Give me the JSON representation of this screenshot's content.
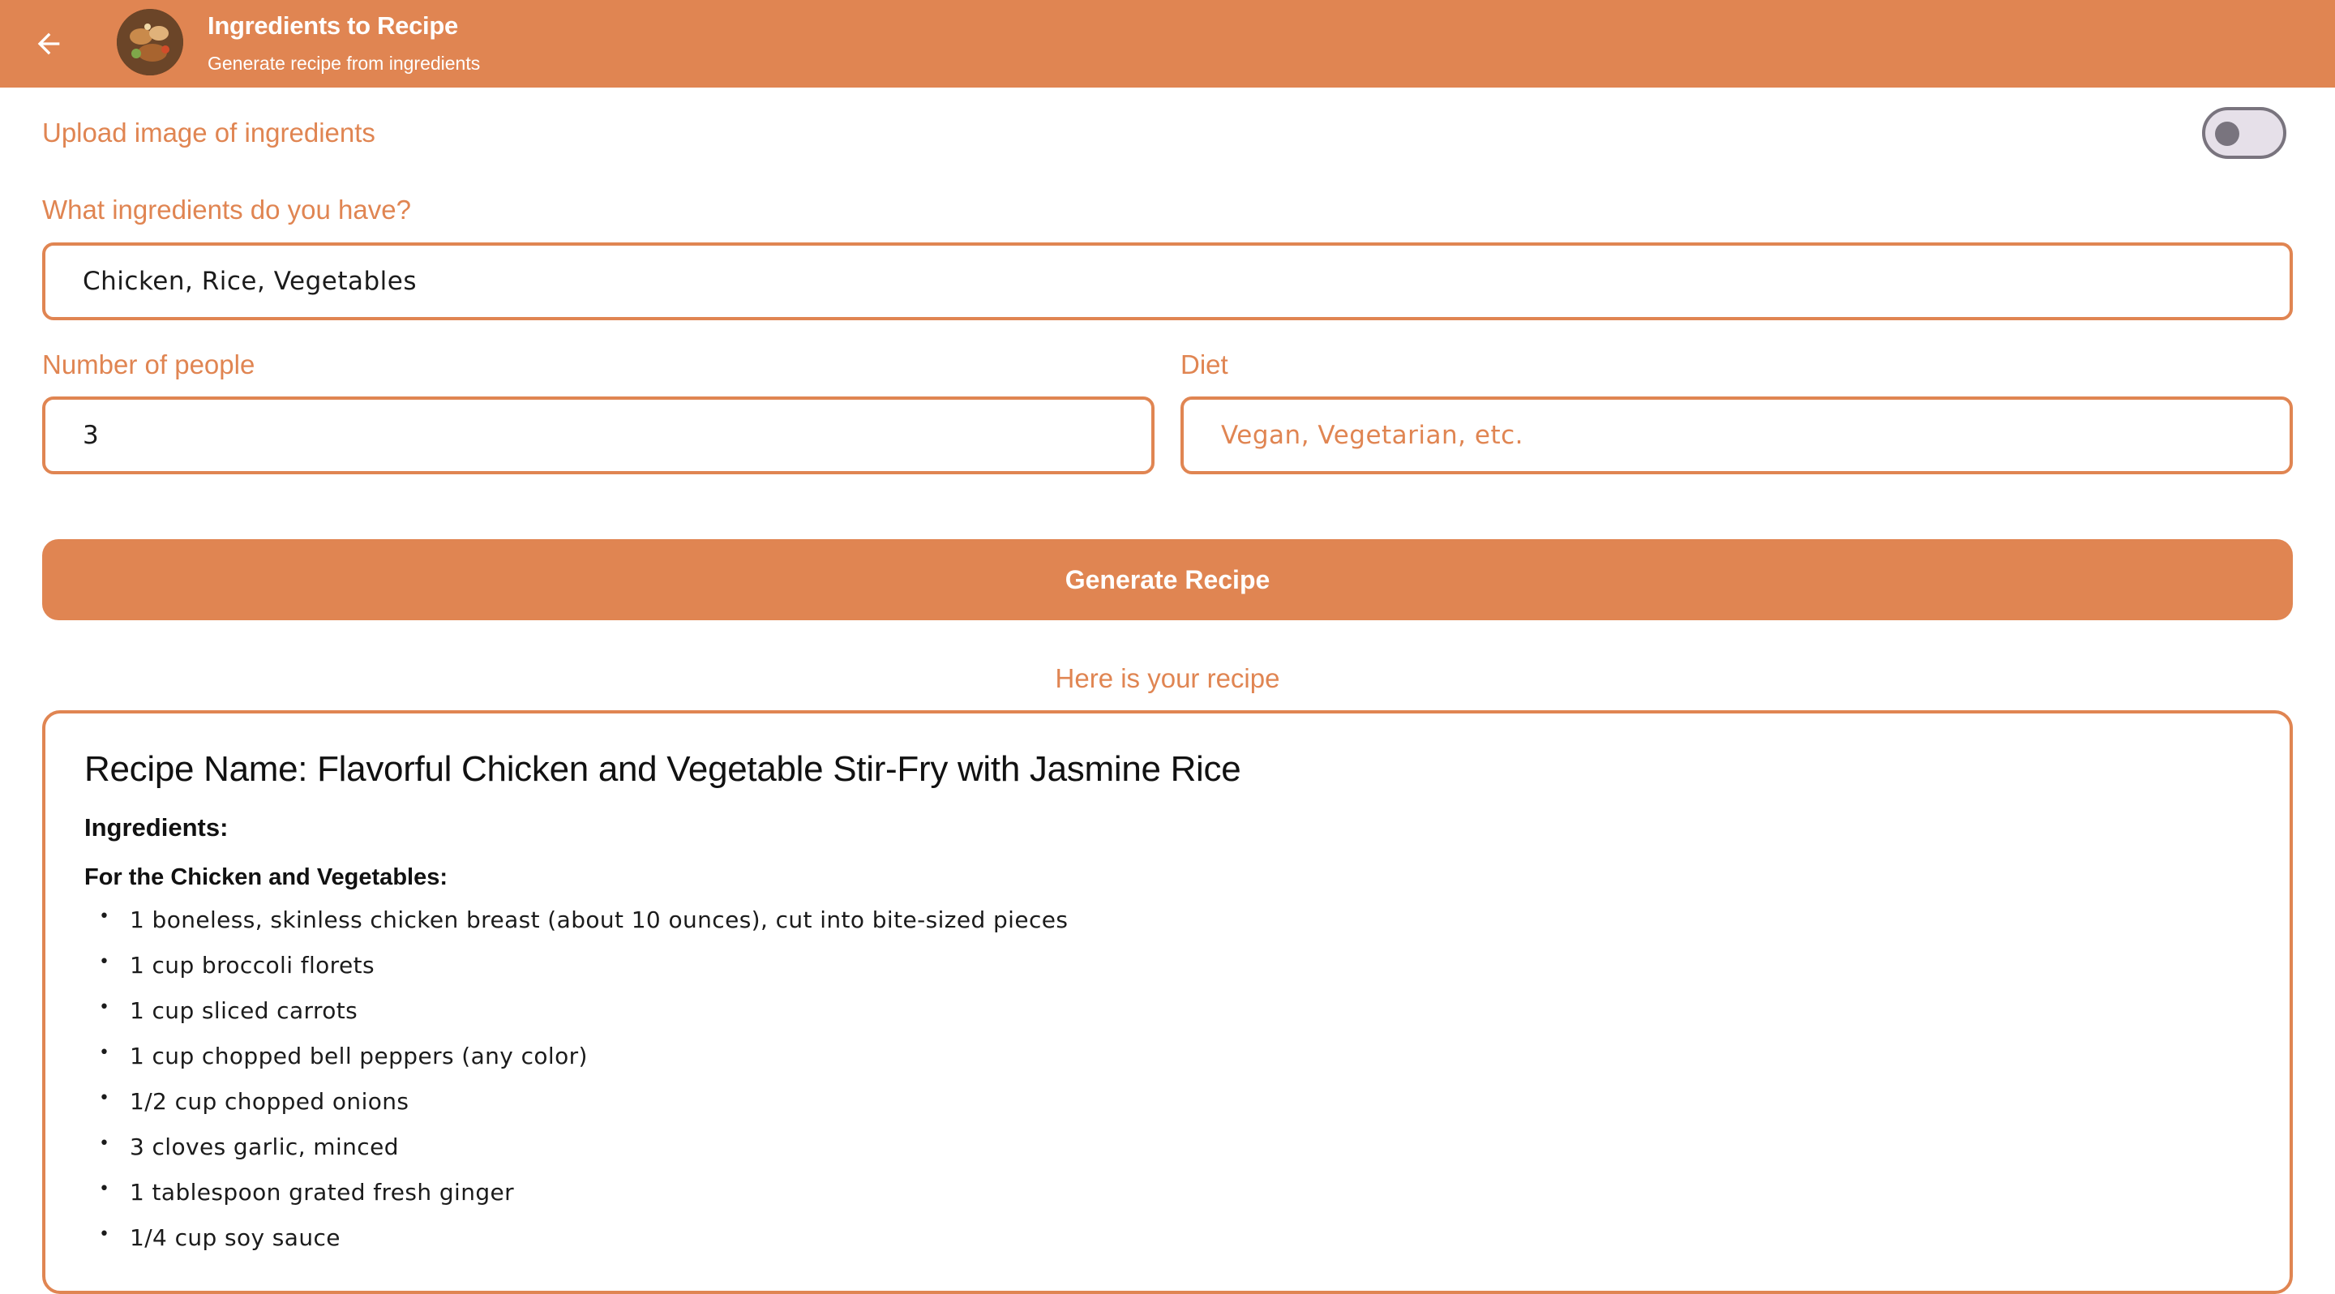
{
  "appbar": {
    "title": "Ingredients to Recipe",
    "subtitle": "Generate recipe from ingredients",
    "back_icon": "arrow-left-icon",
    "avatar_icon": "food-photo-avatar",
    "color": "#E08552"
  },
  "upload": {
    "label": "Upload image of ingredients",
    "toggle_on": false
  },
  "ingredients_field": {
    "label": "What ingredients do you have?",
    "value": "Chicken, Rice, Vegetables"
  },
  "people_field": {
    "label": "Number of people",
    "value": "3"
  },
  "diet_field": {
    "label": "Diet",
    "placeholder": "Vegan, Vegetarian, etc."
  },
  "generate_button": {
    "label": "Generate Recipe"
  },
  "result": {
    "heading": "Here is your recipe",
    "recipe_name": "Recipe Name: Flavorful Chicken and Vegetable Stir-Fry with Jasmine Rice",
    "ingredients_heading": "Ingredients:",
    "section_heading": "For the Chicken and Vegetables:",
    "bullet": "•",
    "items": [
      "1 boneless, skinless chicken breast (about 10 ounces), cut into bite-sized pieces",
      "1 cup broccoli florets",
      "1 cup sliced carrots",
      "1 cup chopped bell peppers (any color)",
      "1/2 cup chopped onions",
      "3 cloves garlic, minced",
      "1 tablespoon grated fresh ginger",
      "1/4 cup soy sauce"
    ]
  }
}
